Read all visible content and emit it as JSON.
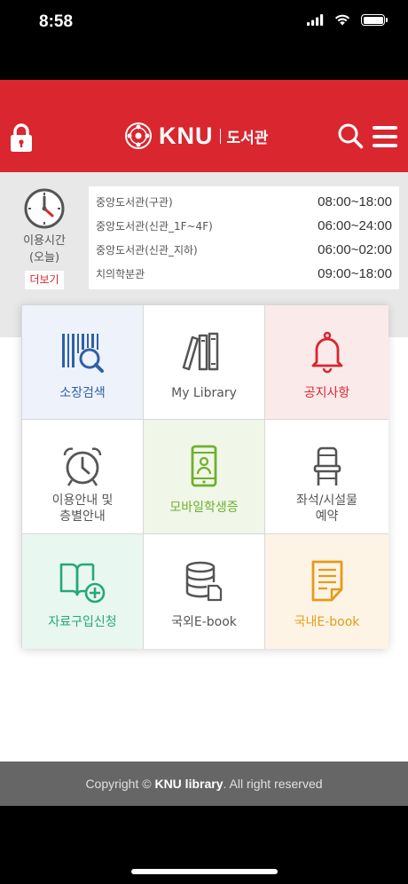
{
  "status_bar": {
    "time": "8:58",
    "icons": [
      "signal-icon",
      "wifi-icon",
      "battery-icon"
    ]
  },
  "header": {
    "brand_name": "KNU",
    "brand_subtitle": "도서관",
    "bg_color": "#d9262f",
    "icons": [
      "lock-icon",
      "search-icon",
      "menu-icon"
    ]
  },
  "hours": {
    "label_line1": "이용시간",
    "label_line2": "(오늘)",
    "more_label": "더보기",
    "rows": [
      {
        "name": "중앙도서관(구관)",
        "time": "08:00~18:00"
      },
      {
        "name": "중앙도서관(신관_1F~4F)",
        "time": "06:00~24:00"
      },
      {
        "name": "중앙도서관(신관_지하)",
        "time": "06:00~02:00"
      },
      {
        "name": "치의학분관",
        "time": "09:00~18:00"
      }
    ]
  },
  "menu": [
    {
      "label": "소장검색",
      "icon": "barcode-search-icon",
      "color": "#2f5fa8",
      "bg": "#edf2fb"
    },
    {
      "label": "My Library",
      "icon": "books-icon",
      "color": "#555555",
      "bg": "#ffffff"
    },
    {
      "label": "공지사항",
      "icon": "bell-icon",
      "color": "#d9262f",
      "bg": "#fbeaea"
    },
    {
      "label": "이용안내 및",
      "label2": "층별안내",
      "icon": "alarm-clock-icon",
      "color": "#555555",
      "bg": "#ffffff"
    },
    {
      "label": "모바일학생증",
      "icon": "mobile-id-icon",
      "color": "#6fb02c",
      "bg": "#f0f6e8"
    },
    {
      "label": "좌석/시설물",
      "label2": "예약",
      "icon": "chair-icon",
      "color": "#555555",
      "bg": "#ffffff"
    },
    {
      "label": "자료구입신청",
      "icon": "book-add-icon",
      "color": "#25a87a",
      "bg": "#e9f7f1"
    },
    {
      "label": "국외E-book",
      "icon": "database-icon",
      "color": "#555555",
      "bg": "#ffffff"
    },
    {
      "label": "국내E-book",
      "icon": "document-icon",
      "color": "#e59b18",
      "bg": "#fdf4e6"
    }
  ],
  "footer": {
    "prefix": "Copyright © ",
    "brand": "KNU library",
    "suffix": ". All right reserved"
  }
}
